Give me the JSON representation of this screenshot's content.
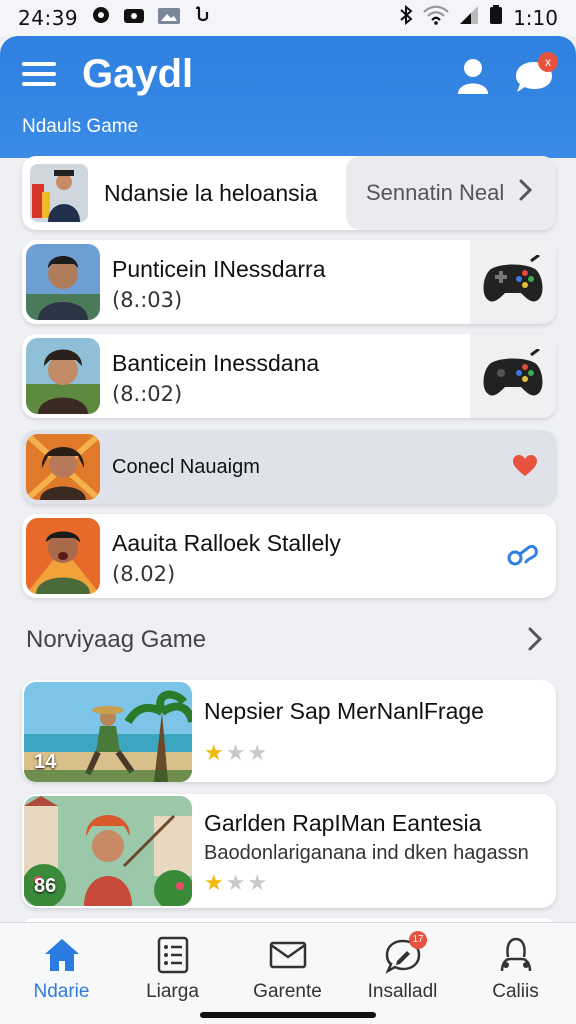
{
  "status_bar": {
    "time": "24:39",
    "clock": "1:10"
  },
  "header": {
    "title": "Gaydl",
    "subtitle": "Ndauls Game",
    "chat_badge": "x"
  },
  "featured": {
    "label": "Ndansie la heloansia",
    "button_label": "Sennatin Neal"
  },
  "friends": [
    {
      "name": "Punticein INessdarra",
      "detail": "(8.:03)"
    },
    {
      "name": "Banticein Inessdana",
      "detail": "(8.:02)"
    },
    {
      "name": "Conecl Nauaigm",
      "detail": ""
    },
    {
      "name": "Aauita Ralloek Stallely",
      "detail": "(8.02)"
    }
  ],
  "section": {
    "title": "Norviyaag Game"
  },
  "games": [
    {
      "title": "Nepsier Sap MerNanlFrage",
      "desc": "",
      "badge": "14",
      "rating": 1
    },
    {
      "title": "Garlden RapIMan Eantesia",
      "desc": "Baodonlariganana ind dken hagassn",
      "badge": "86",
      "rating": 1
    }
  ],
  "nav": [
    {
      "label": "Ndarie",
      "icon": "home-icon",
      "active": true
    },
    {
      "label": "Liarga",
      "icon": "list-icon",
      "active": false
    },
    {
      "label": "Garente",
      "icon": "mail-icon",
      "active": false
    },
    {
      "label": "Insalladl",
      "icon": "chat-edit-icon",
      "active": false,
      "badge": "17"
    },
    {
      "label": "Caliis",
      "icon": "person-icon",
      "active": false
    }
  ],
  "colors": {
    "accent": "#2f80e0",
    "star": "#f1b90f",
    "heart": "#e8533f",
    "background": "#eef0f4"
  }
}
